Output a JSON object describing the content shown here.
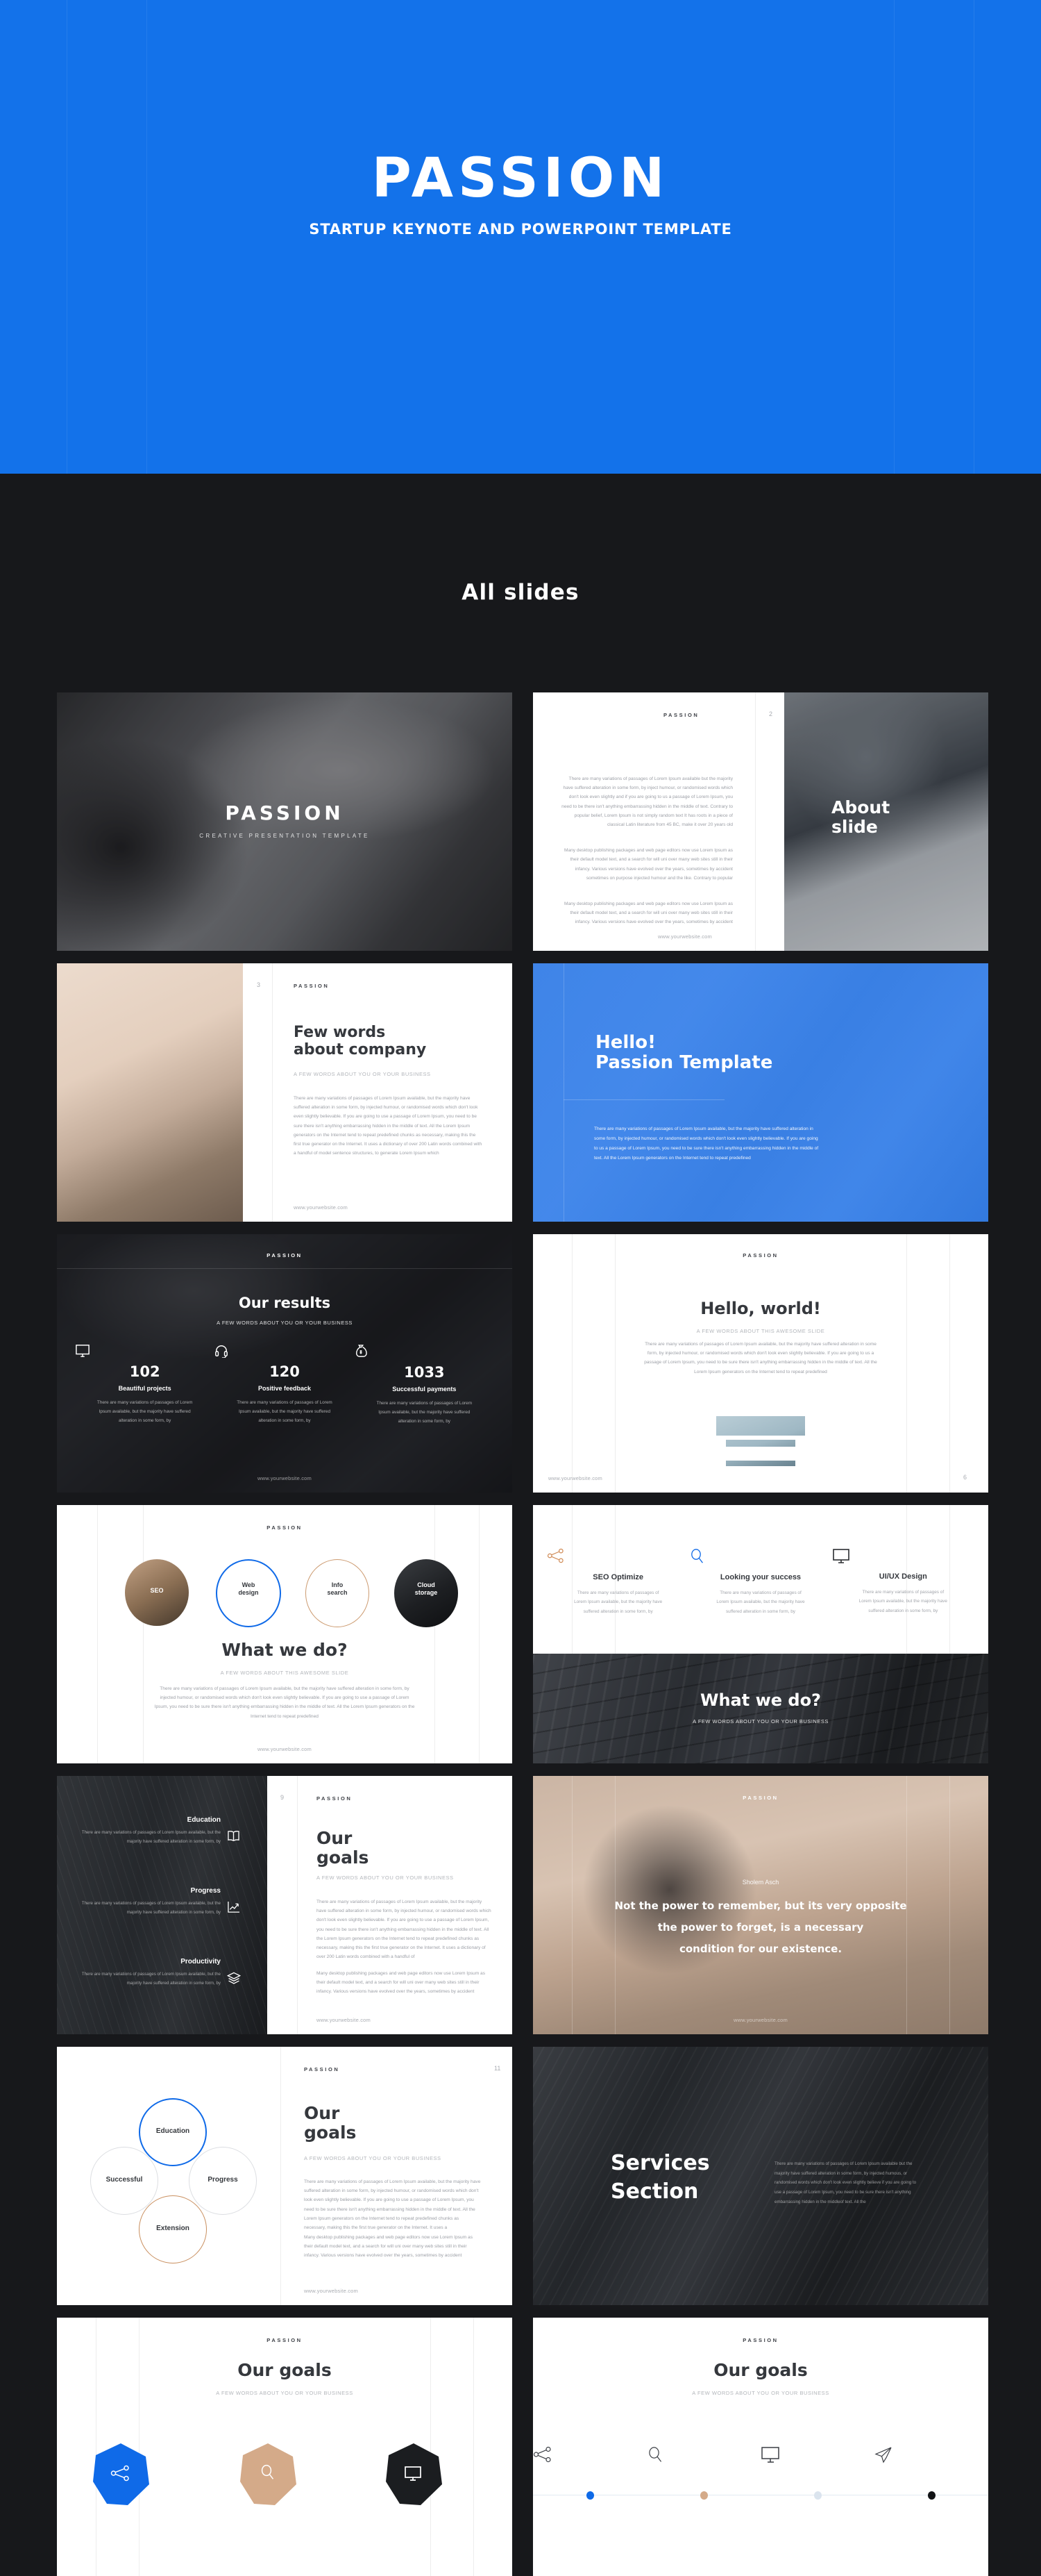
{
  "hero": {
    "title": "PASSION",
    "subtitle": "STARTUP KEYNOTE AND POWERPOINT TEMPLATE",
    "bg_color": "#1372ea"
  },
  "section": {
    "title": "All slides",
    "bg_color": "#17181b"
  },
  "common": {
    "brand": "PASSION",
    "website": "www.yourwebsite.com",
    "sub_business": "A FEW WORDS ABOUT YOU OR YOUR BUSINESS",
    "sub_awesome": "A FEW WORDS ABOUT THIS AWESOME SLIDE",
    "lorem_short": "There are many variations of passages of Lorem Ipsum available, but the majority have suffered alteration in some form, by",
    "accent_blue": "#0f6ae8",
    "accent_tan": "#c99b72",
    "accent_dark": "#1b1d20"
  },
  "slides": [
    {
      "id": 1,
      "kind": "cover-photo",
      "title": "PASSION",
      "subtitle": "CREATIVE PRESENTATION TEMPLATE"
    },
    {
      "id": 2,
      "kind": "about-split",
      "brand": "PASSION",
      "page": "2",
      "title": "About\nslide",
      "title_line1": "About",
      "title_line2": "slide",
      "paragraphs": [
        "There are many variations of passages of Lorem Ipsum available but the majority have suffered alteration in some form, by inject humour, or randomised words which don't look even slightly and if you are going to us a passage of Lorem Ipsum, you need to be there isn't anything embarrassing hidden in the middle of text. Contrary to popular belief, Lorem Ipsum is not simply random text It has roots in a piece of classical Latin literature from 45 BC, make it over 20 years old",
        "Many desktop publishing packages and web page editors now use Lorem Ipsum as their default model text, and a search for will uni over many web sites still in their infancy. Various versions have evolved over the years, sometimes by accident sometimes on purpose injected humour and the like. Contrary to popular",
        "Many desktop publishing packages and web page editors now use Lorem Ipsum as their default model text, and a search for will uni over many web sites still in their infancy. Various versions have evolved over the years, sometimes by accident"
      ],
      "website": "www.yourwebsite.com"
    },
    {
      "id": 3,
      "kind": "few-words",
      "brand": "PASSION",
      "page": "3",
      "title_line1": "Few words",
      "title_line2": "about company",
      "subtitle": "A FEW WORDS ABOUT YOU OR YOUR BUSINESS",
      "body": "There are many variations of passages of Lorem Ipsum available, but the majority have suffered alteration in some form, by injected humour, or randomised words which don't look even slightly believable. If you are going to use a passage of Lorem Ipsum, you need to be sure there isn't anything embarrassing hidden in the middle of text. All the Lorem Ipsum generators on the Internet tend to repeat predefined chunks as necessary, making this the first true generator on the Internet. It uses a dictionary of over 200 Latin words combined with a handful of model sentence structures, to generate Lorem Ipsum which",
      "website": "www.yourwebsite.com"
    },
    {
      "id": 4,
      "kind": "hello-blue",
      "title_line1": "Hello!",
      "title_line2": "Passion Template",
      "body": "There are many variations of passages of Lorem Ipsum available, but the majority have suffered alteration in some form, by injected humour, or randomised words which don't look even slightly believable. If you are going to us a passage of Lorem Ipsum, you need to be sure there isn't anything embarrassing hidden in the middle of text. All the Lorem Ipsum generators on the Internet tend to repeat predefined"
    },
    {
      "id": 5,
      "kind": "results",
      "brand": "PASSION",
      "title": "Our results",
      "subtitle": "A FEW WORDS ABOUT YOU OR YOUR BUSINESS",
      "website": "www.yourwebsite.com",
      "stats": [
        {
          "icon": "monitor-icon",
          "value": "102",
          "label": "Beautiful projects",
          "desc": "There are many variations of passages of Lorem Ipsum available, but the majority have suffered alteration in some form, by"
        },
        {
          "icon": "headset-icon",
          "value": "120",
          "label": "Positive feedback",
          "desc": "There are many variations of passages of Lorem Ipsum available, but the majority have suffered alteration in some form, by"
        },
        {
          "icon": "moneybag-icon",
          "value": "1033",
          "label": "Successful payments",
          "desc": "There are many variations of passages of Lorem Ipsum available, but the majority have suffered alteration in some form, by"
        }
      ]
    },
    {
      "id": 6,
      "kind": "hello-world",
      "brand": "PASSION",
      "page": "6",
      "title": "Hello, world!",
      "subtitle": "A FEW WORDS ABOUT THIS AWESOME SLIDE",
      "body": "There are many variations of passages of Lorem Ipsum available, but the majority have suffered alteration in some form, by injected humour, or randomised words which don't look even slightly believable. If you are going to us a passage of Lorem Ipsum, you need to be sure there isn't anything embarrassing hidden in the middle of text. All the Lorem Ipsum generators on the Internet tend to repeat predefined",
      "website": "www.yourwebsite.com"
    },
    {
      "id": 7,
      "kind": "what-we-do-circles",
      "brand": "PASSION",
      "title": "What we do?",
      "subtitle": "A FEW WORDS ABOUT THIS AWESOME SLIDE",
      "body": "There are many variations of passages of Lorem Ipsum available, but the majority have suffered alteration in some form, by injected humour, or randomised words which don't look even slightly believable. If you are going to use a passage of Lorem Ipsum, you need to be sure there isn't anything embarrassing hidden in the middle of text. All the Lorem Ipsum generators on the Internet tend to repeat predefined",
      "website": "www.yourwebsite.com",
      "circles": [
        {
          "label": "SEO",
          "style": "photo"
        },
        {
          "label": "Web\ndesign",
          "l1": "Web",
          "l2": "design",
          "style": "outline-blue"
        },
        {
          "label": "Info\nsearch",
          "l1": "Info",
          "l2": "search",
          "style": "outline-tan"
        },
        {
          "label": "Cloud\nstorage",
          "l1": "Cloud",
          "l2": "storage",
          "style": "photo-dark"
        }
      ]
    },
    {
      "id": 8,
      "kind": "what-we-do-icons",
      "title": "What we do?",
      "subtitle": "A FEW WORDS ABOUT YOU OR YOUR BUSINESS",
      "features": [
        {
          "icon": "share-icon",
          "color": "#d08b56",
          "title": "SEO Optimize",
          "desc": "There are many variations of passages of Lorem Ipsum available, but the majority have suffered alteration in some form, by"
        },
        {
          "icon": "search-icon",
          "color": "#0f6ae8",
          "title": "Looking your success",
          "desc": "There are many variations of passages of Lorem Ipsum available, but the majority have suffered alteration in some form, by"
        },
        {
          "icon": "monitor-icon",
          "color": "#2b2d31",
          "title": "UI/UX Design",
          "desc": "There are many variations of passages of Lorem Ipsum available, but the majority have suffered alteration in some form, by"
        }
      ]
    },
    {
      "id": 9,
      "kind": "goals-list",
      "brand": "PASSION",
      "page": "9",
      "title_line1": "Our",
      "title_line2": "goals",
      "subtitle": "A FEW WORDS ABOUT YOU OR YOUR BUSINESS",
      "paragraphs": [
        "There are many variations of passages of Lorem Ipsum available, but the majority have suffered alteration in some form, by injected humour, or randomised words which don't look even slightly believable. If you are going to use a passage of Lorem Ipsum, you need to be sure there isn't anything embarrassing hidden in the middle of text. All the Lorem Ipsum generators on the Internet tend to repeat predefined chunks as necessary, making this the first true generator on the Internet. It uses a dictionary of over 200 Latin words combined with a handful of",
        "Many desktop publishing packages and web page editors now use Lorem Ipsum as their default model text, and a search for will uni over many web sites still in their infancy. Various versions have evolved over the years, sometimes by accident"
      ],
      "website": "www.yourwebsite.com",
      "items": [
        {
          "icon": "book-icon",
          "title": "Education",
          "desc": "There are many variations of passages of Lorem Ipsum available, but the majority have suffered alteration in some form, by"
        },
        {
          "icon": "chart-up-icon",
          "title": "Progress",
          "desc": "There are many variations of passages of Lorem Ipsum available, but the majority have suffered alteration in some form, by"
        },
        {
          "icon": "layers-icon",
          "title": "Productivity",
          "desc": "There are many variations of passages of Lorem Ipsum available, but the majority have suffered alteration in some form, by"
        }
      ]
    },
    {
      "id": 10,
      "kind": "quote",
      "brand": "PASSION",
      "author": "Sholem Asch",
      "quote_line1": "Not the power to remember, but its very opposite",
      "quote_line2": "the power to forget, is a necessary",
      "quote_line3": "condition for our existence.",
      "website": "www.yourwebsite.com"
    },
    {
      "id": 11,
      "kind": "goals-venn",
      "brand": "PASSION",
      "page": "11",
      "title_line1": "Our",
      "title_line2": "goals",
      "subtitle": "A FEW WORDS ABOUT YOU OR YOUR BUSINESS",
      "paragraphs": [
        "There are many variations of passages of Lorem Ipsum available, but the majority have suffered alteration in some form, by injected humour, or randomised words which don't look even slightly believable. If you are going to use a passage of Lorem Ipsum, you need to be sure there isn't anything embarrassing hidden in the middle of text. All the Lorem Ipsum generators on the Internet tend to repeat predefined chunks as necessary, making this the first true generator on the Internet. It uses a",
        "Many desktop publishing packages and web page editors now use Lorem Ipsum as their default model text, and a search for will uni over many web sites still in their infancy. Various versions have evolved over the years, sometimes by accident"
      ],
      "website": "www.yourwebsite.com",
      "bubbles": [
        {
          "label": "Education",
          "color": "#0f6ae8"
        },
        {
          "label": "Successful",
          "color": "#dcdee2"
        },
        {
          "label": "Progress",
          "color": "#dcdee2"
        },
        {
          "label": "Extension",
          "color": "#c98f5f"
        }
      ]
    },
    {
      "id": 12,
      "kind": "services-section",
      "title_line1": "Services",
      "title_line2": "Section",
      "body": "There are many variations of passages of Lorem Ipsum available but the majority have suffered alteration in some form, by injected humous, or randomised words which don't look even slightly believe if you are going to use a passage of Lorem Ipsum, you need to be sure there isn't anything embarrassing hidden in the middleof text. All the"
    },
    {
      "id": 13,
      "kind": "goals-hex",
      "brand": "PASSION",
      "title": "Our goals",
      "subtitle": "A FEW WORDS ABOUT YOU OR YOUR BUSINESS",
      "hexes": [
        {
          "icon": "share-icon",
          "color": "#0f6ae8"
        },
        {
          "icon": "search-icon",
          "color": "#d4aa89"
        },
        {
          "icon": "monitor-icon",
          "color": "#1b1d20"
        }
      ]
    },
    {
      "id": 14,
      "kind": "goals-timeline",
      "brand": "PASSION",
      "title": "Our goals",
      "subtitle": "A FEW WORDS ABOUT YOU OR YOUR BUSINESS",
      "steps": [
        {
          "icon": "share-icon",
          "dot": "#0f6ae8"
        },
        {
          "icon": "search-icon",
          "dot": "#d4aa89"
        },
        {
          "icon": "monitor-icon",
          "dot": "#dbe4ee"
        },
        {
          "icon": "send-icon",
          "dot": "#121316"
        }
      ]
    }
  ]
}
